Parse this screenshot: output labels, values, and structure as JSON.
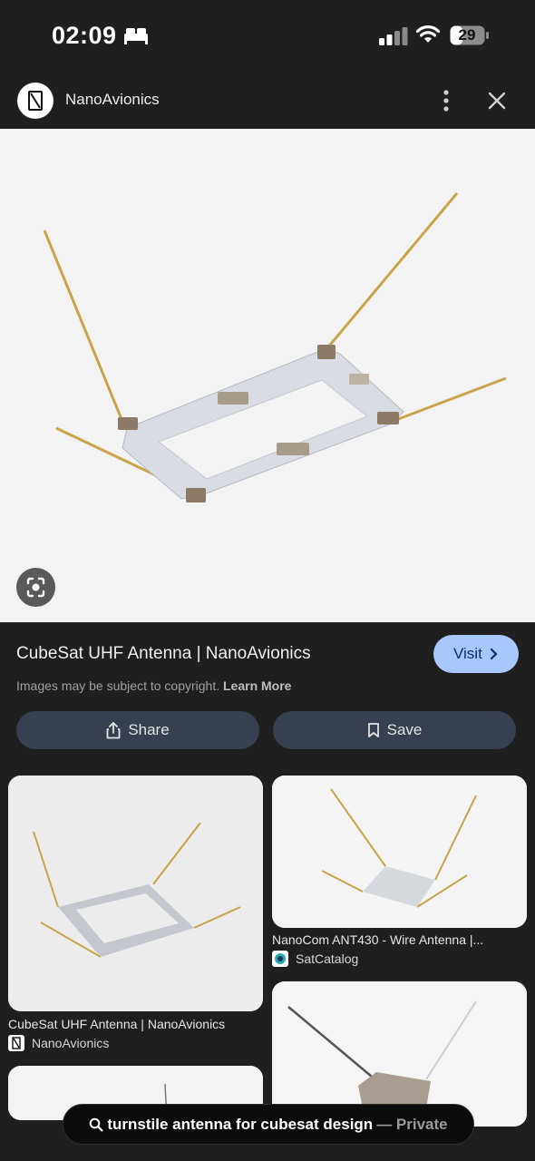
{
  "status_bar": {
    "time": "02:09",
    "battery": "29",
    "icons": [
      "bed-icon",
      "signal-icon",
      "wifi-icon",
      "battery-icon"
    ]
  },
  "header": {
    "site_name": "NanoAvionics",
    "icons": [
      "site-logo-icon",
      "more-vert-icon",
      "close-icon"
    ]
  },
  "result": {
    "title": "CubeSat UHF Antenna | NanoAvionics",
    "visit_label": "Visit",
    "copyright_text": "Images may be subject to copyright.",
    "learn_more": "Learn More",
    "share_label": "Share",
    "save_label": "Save"
  },
  "related": [
    {
      "title": "CubeSat UHF Antenna | NanoAvionics",
      "source": "NanoAvionics"
    },
    {
      "title": "NanoCom ANT430 - Wire Antenna |...",
      "source": "SatCatalog"
    }
  ],
  "search": {
    "query": "turnstile antenna for cubesat design",
    "mode": "— Private"
  },
  "colors": {
    "background": "#1f1f1f",
    "visit_button": "#a8c7fa",
    "action_button": "#37404e"
  }
}
